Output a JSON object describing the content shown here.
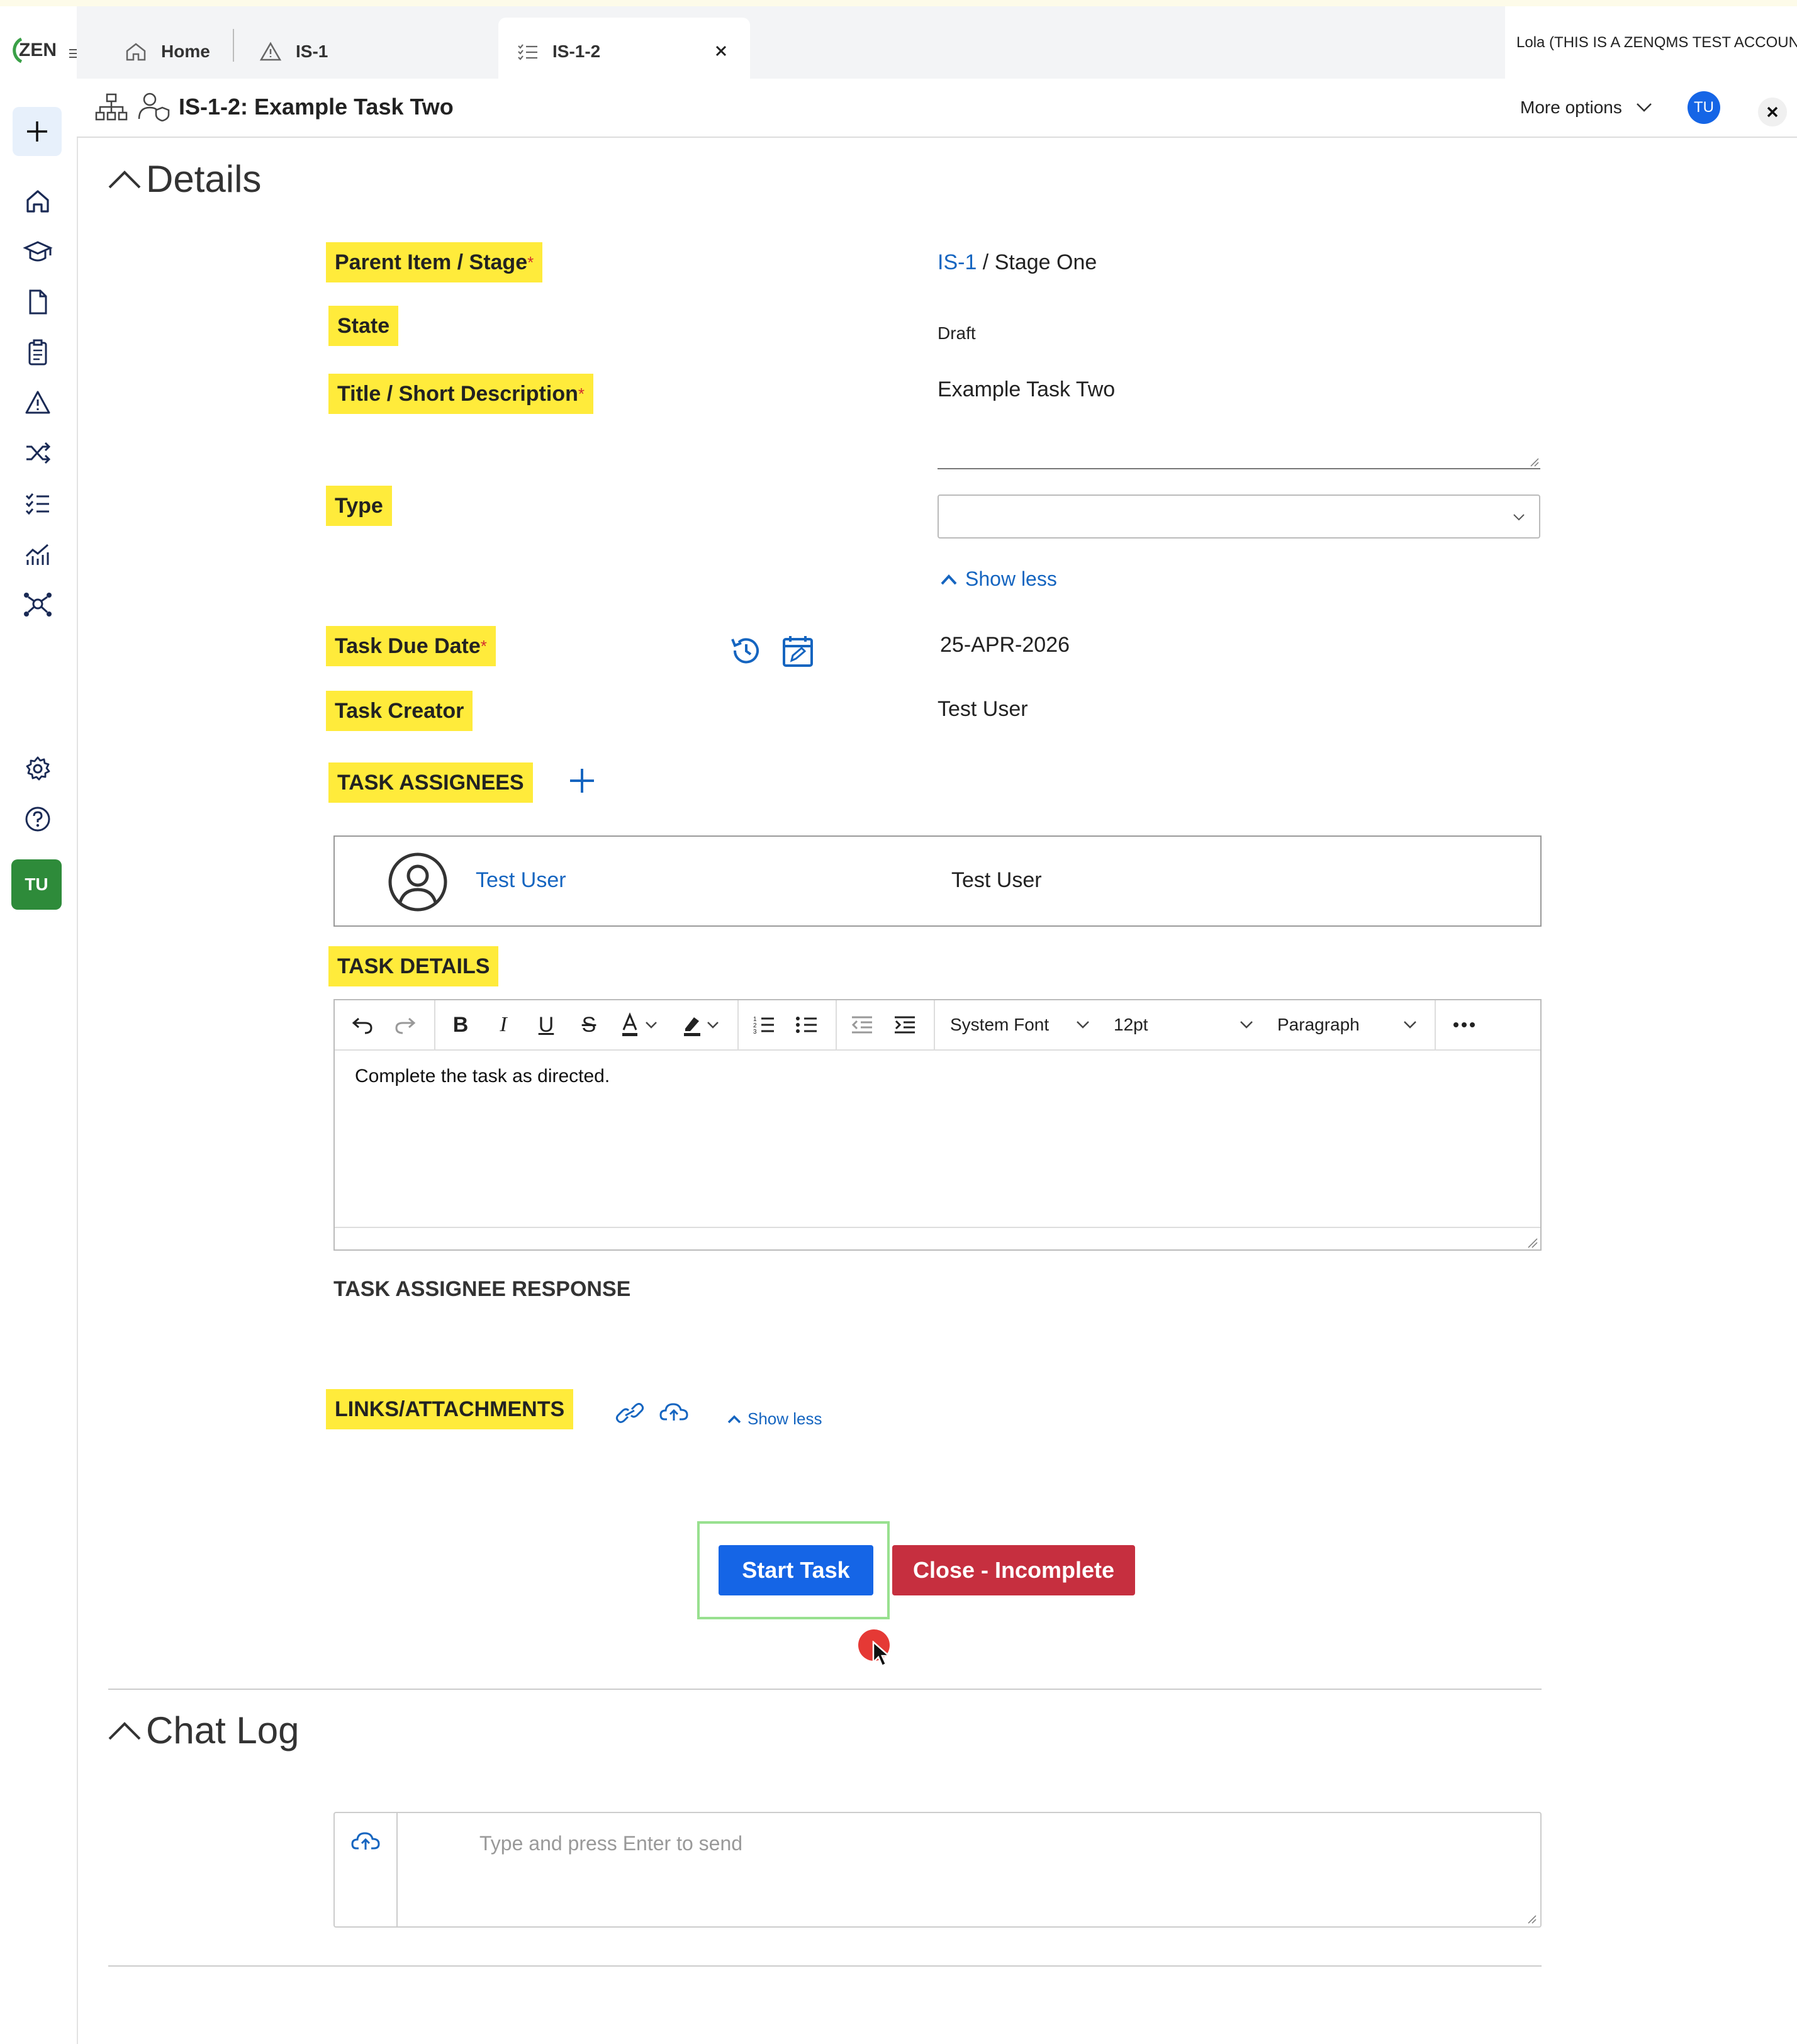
{
  "sidebar": {
    "logo": "ZEN",
    "avatar": "TU",
    "icons": [
      "add-icon",
      "home-icon",
      "training-icon",
      "document-icon",
      "clipboard-icon",
      "warning-icon",
      "shuffle-icon",
      "checklist-icon",
      "analytics-icon",
      "network-icon",
      "settings-icon",
      "help-icon"
    ]
  },
  "tabs": [
    {
      "label": "Home",
      "icon": "home-icon"
    },
    {
      "label": "IS-1",
      "icon": "warning-icon"
    },
    {
      "label": "IS-1-2",
      "icon": "checklist-icon",
      "active": true
    }
  ],
  "account_label": "Lola (THIS IS A ZENQMS TEST ACCOUNT)",
  "header": {
    "title": "IS-1-2: Example Task Two",
    "more_options": "More options",
    "avatar": "TU"
  },
  "details": {
    "section_title": "Details",
    "parent_label": "Parent Item / Stage",
    "parent_link": "IS-1",
    "parent_rest": " / Stage One",
    "state_label": "State",
    "state_value": "Draft",
    "title_label": "Title / Short Description",
    "title_value": "Example Task Two",
    "type_label": "Type",
    "type_value": "",
    "show_less": "Show less",
    "due_label": "Task Due Date",
    "due_value": "25-APR-2026",
    "creator_label": "Task Creator",
    "creator_value": "Test User",
    "assignees_label": "TASK ASSIGNEES",
    "assignee_link": "Test User",
    "assignee_name": "Test User",
    "task_details_label": "TASK DETAILS",
    "editor": {
      "font": "System Font",
      "size": "12pt",
      "block": "Paragraph",
      "content": "Complete the task as directed."
    },
    "response_label": "TASK ASSIGNEE RESPONSE",
    "links_label": "LINKS/ATTACHMENTS",
    "links_show_less": "Show less",
    "start_button": "Start Task",
    "close_button": "Close - Incomplete"
  },
  "chat": {
    "section_title": "Chat Log",
    "placeholder": "Type and press Enter to send"
  },
  "colors": {
    "highlight": "#ffeb3b",
    "primary": "#1565e6",
    "danger": "#c62f3f",
    "link": "#1565c0",
    "avatar_green": "#2e8b3a"
  }
}
